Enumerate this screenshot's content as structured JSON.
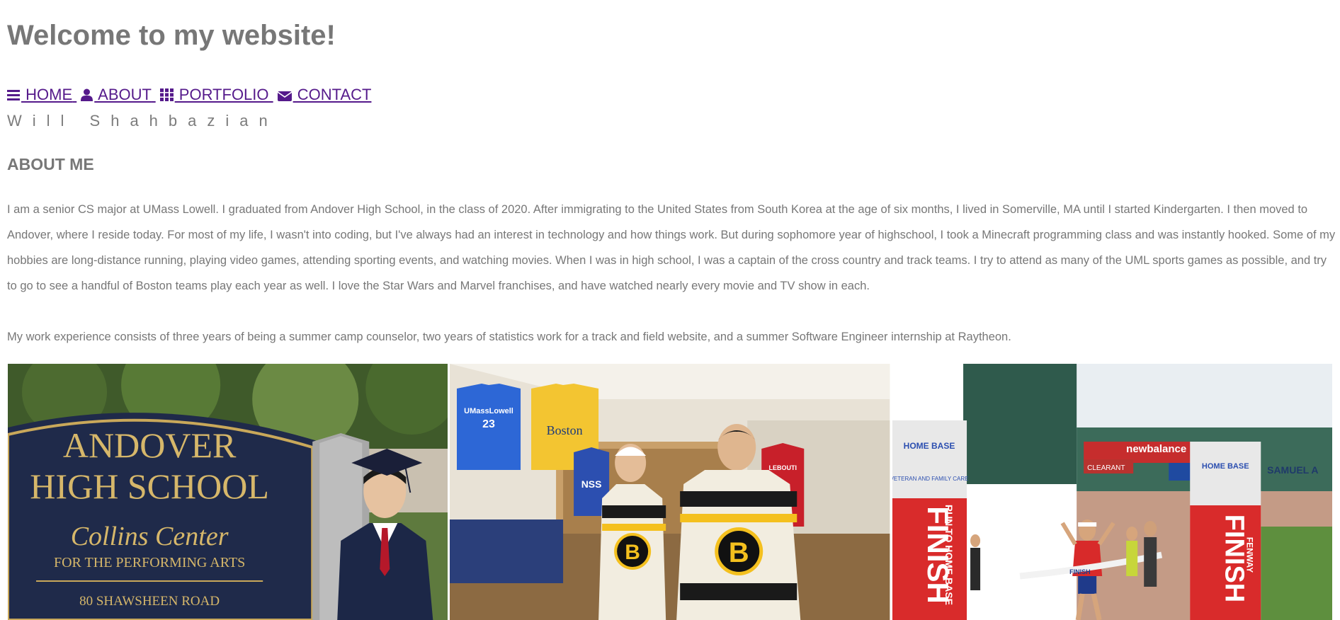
{
  "header": {
    "title": "Welcome to my website!"
  },
  "nav": {
    "items": [
      {
        "label": " HOME",
        "icon": "menu-icon"
      },
      {
        "label": " ABOUT",
        "icon": "user-icon"
      },
      {
        "label": " PORTFOLIO",
        "icon": "grid-icon"
      },
      {
        "label": " CONTACT",
        "icon": "envelope-icon"
      }
    ],
    "link_color": "#551a8b"
  },
  "author": {
    "name": "Will Shahbazian"
  },
  "about": {
    "heading": "ABOUT ME",
    "paragraph_1": "I am a senior CS major at UMass Lowell. I graduated from Andover High School, in the class of 2020. After immigrating to the United States from South Korea at the age of six months, I lived in Somerville, MA until I started Kindergarten. I then moved to Andover, where I reside today. For most of my life, I wasn't into coding, but I've always had an interest in technology and how things work. But during sophomore year of highschool, I took a Minecraft programming class and was instantly hooked. Some of my hobbies are long-distance running, playing video games, attending sporting events, and watching movies. When I was in high school, I was a captain of the cross country and track teams. I try to attend as many of the UML sports games as possible, and try to go to see a handful of Boston teams play each year as well. I love the Star Wars and Marvel franchises, and have watched nearly every movie and TV show in each.",
    "paragraph_2": "My work experience consists of three years of being a summer camp counselor, two years of statistics work for a track and field website, and a summer Software Engineer internship at Raytheon."
  },
  "photos": [
    {
      "sign_line_1": "ANDOVER",
      "sign_line_2": "HIGH SCHOOL",
      "sign_line_3": "Collins Center",
      "sign_line_4": "FOR THE PERFORMING ARTS",
      "sign_line_5": "80  SHAWSHEEN  ROAD"
    },
    {
      "jersey_1": "UMassLowell",
      "jersey_1_number": "23",
      "jersey_2": "Boston",
      "jersey_3": "NSS",
      "jersey_4": "LEBOUTI",
      "jersey_logo": "B"
    },
    {
      "banner_word": "FINISH",
      "banner_side": "RUN TO HOME BASE",
      "banner_side_2": "FENWAY",
      "sponsor_logo": "HOME BASE",
      "sponsor_sub": "VETERAN AND FAMILY CARE",
      "ad_1": "newbalance",
      "ad_2": "CLEARANT",
      "ad_3": "SAMUEL A",
      "tape_text": "FINISH"
    }
  ],
  "colors": {
    "text": "#777777",
    "link": "#551a8b"
  }
}
